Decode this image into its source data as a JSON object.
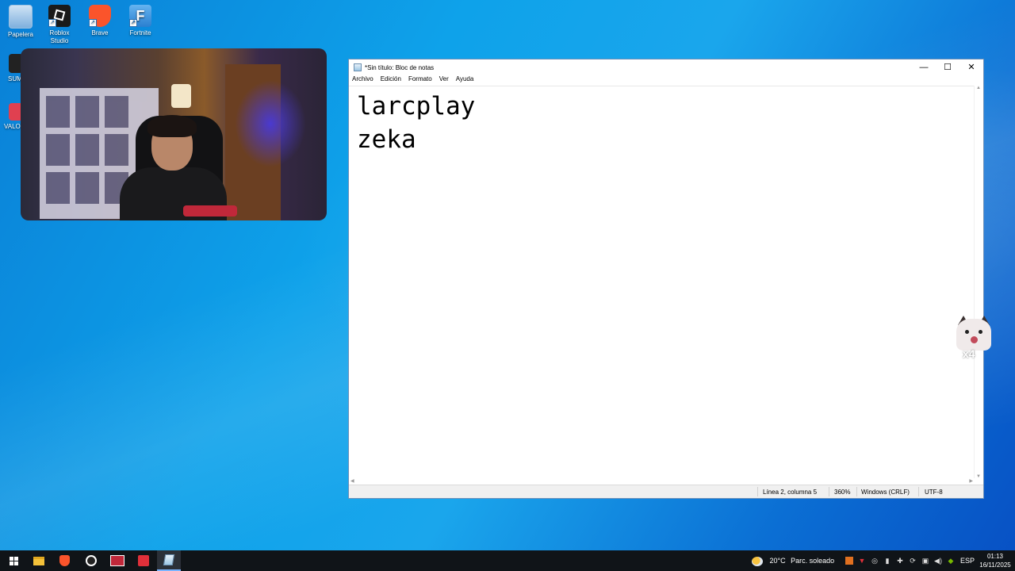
{
  "desktop": {
    "icons": [
      {
        "label": "Papelera"
      },
      {
        "label": "Roblox\nStudio"
      },
      {
        "label": "Brave"
      },
      {
        "label": "Fortnite"
      },
      {
        "label": "SUM"
      },
      {
        "label": "VALO"
      }
    ]
  },
  "notepad": {
    "title": "*Sin título: Bloc de notas",
    "menu": [
      "Archivo",
      "Edición",
      "Formato",
      "Ver",
      "Ayuda"
    ],
    "content_lines": [
      "larcplay",
      "zeka"
    ],
    "status": {
      "position": "Línea 2, columna 5",
      "zoom": "360%",
      "line_ending": "Windows (CRLF)",
      "encoding": "UTF-8"
    },
    "window_buttons": {
      "minimize": "—",
      "maximize": "☐",
      "close": "✕"
    }
  },
  "cat_overlay": {
    "label": "x4"
  },
  "taskbar": {
    "weather": {
      "temp": "20°C",
      "condition": "Parc. soleado"
    },
    "language": "ESP",
    "time": "01:13",
    "date": "16/11/2025"
  },
  "colors": {
    "desktop_accent": "#0ea2ea",
    "taskbar_bg": "#101418",
    "brave_orange": "#fb542b",
    "roblox_black": "#1a1a1a"
  }
}
